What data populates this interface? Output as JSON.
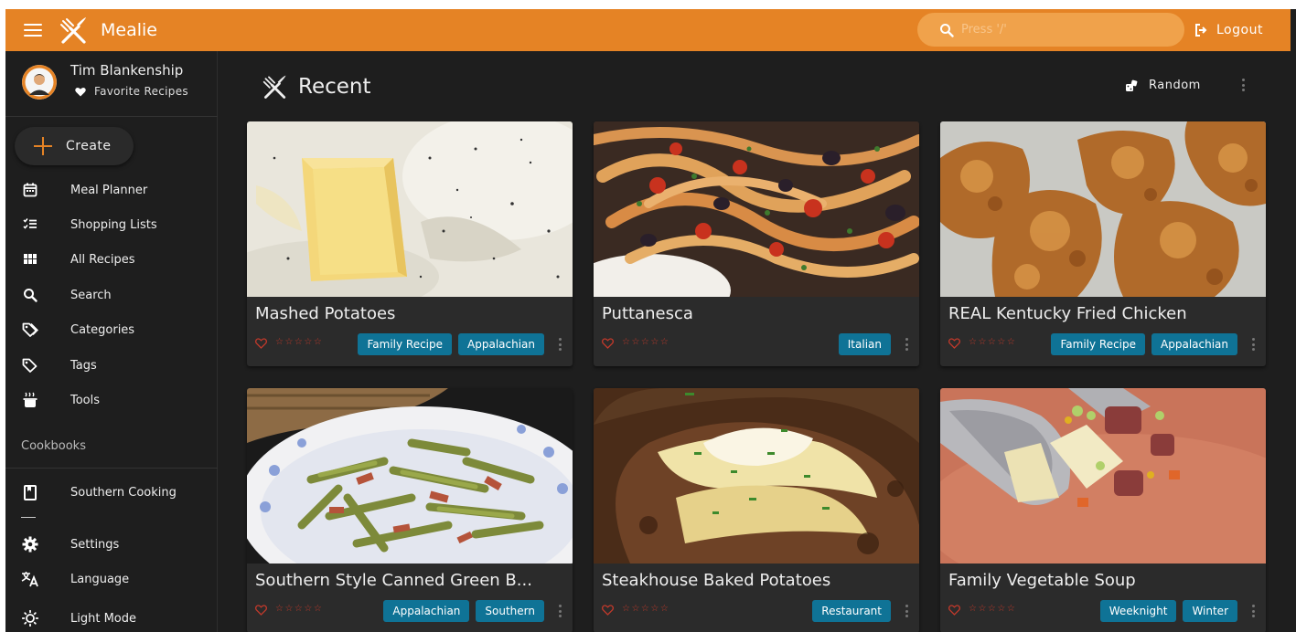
{
  "app": {
    "title": "Mealie"
  },
  "search": {
    "placeholder": "Press '/'"
  },
  "header": {
    "logout_label": "Logout"
  },
  "user": {
    "name": "Tim Blankenship",
    "favorites_label": "Favorite Recipes"
  },
  "sidebar": {
    "create_label": "Create",
    "items": [
      {
        "label": "Meal Planner",
        "icon": "calendar-icon"
      },
      {
        "label": "Shopping Lists",
        "icon": "checklist-icon"
      },
      {
        "label": "All Recipes",
        "icon": "grid-icon"
      },
      {
        "label": "Search",
        "icon": "search-icon"
      },
      {
        "label": "Categories",
        "icon": "tag-icon"
      },
      {
        "label": "Tags",
        "icon": "tag-icon"
      },
      {
        "label": "Tools",
        "icon": "pot-steam-icon"
      }
    ],
    "cookbooks_label": "Cookbooks",
    "cookbooks": [
      {
        "label": "Southern Cooking",
        "icon": "book-icon"
      }
    ],
    "bottom_items": [
      {
        "label": "Settings",
        "icon": "gear-icon"
      },
      {
        "label": "Language",
        "icon": "translate-icon"
      },
      {
        "label": "Light Mode",
        "icon": "sun-icon"
      }
    ]
  },
  "main": {
    "title": "Recent",
    "random_label": "Random",
    "recipes": [
      {
        "title": "Mashed Potatoes",
        "tags": [
          "Family Recipe",
          "Appalachian"
        ],
        "rating": 0
      },
      {
        "title": "Puttanesca",
        "tags": [
          "Italian"
        ],
        "rating": 0
      },
      {
        "title": "REAL Kentucky Fried Chicken",
        "tags": [
          "Family Recipe",
          "Appalachian"
        ],
        "rating": 0
      },
      {
        "title": "Southern Style Canned Green B...",
        "tags": [
          "Appalachian",
          "Southern"
        ],
        "rating": 0
      },
      {
        "title": "Steakhouse Baked Potatoes",
        "tags": [
          "Restaurant"
        ],
        "rating": 0
      },
      {
        "title": "Family Vegetable Soup",
        "tags": [
          "Weeknight",
          "Winter"
        ],
        "rating": 0
      }
    ],
    "star_glyphs": "☆☆☆☆☆"
  },
  "colors": {
    "accent": "#e58325",
    "tag": "#0f7396",
    "background": "#1e1e1e",
    "card": "#2b2b2b",
    "heart": "#c0392b"
  }
}
